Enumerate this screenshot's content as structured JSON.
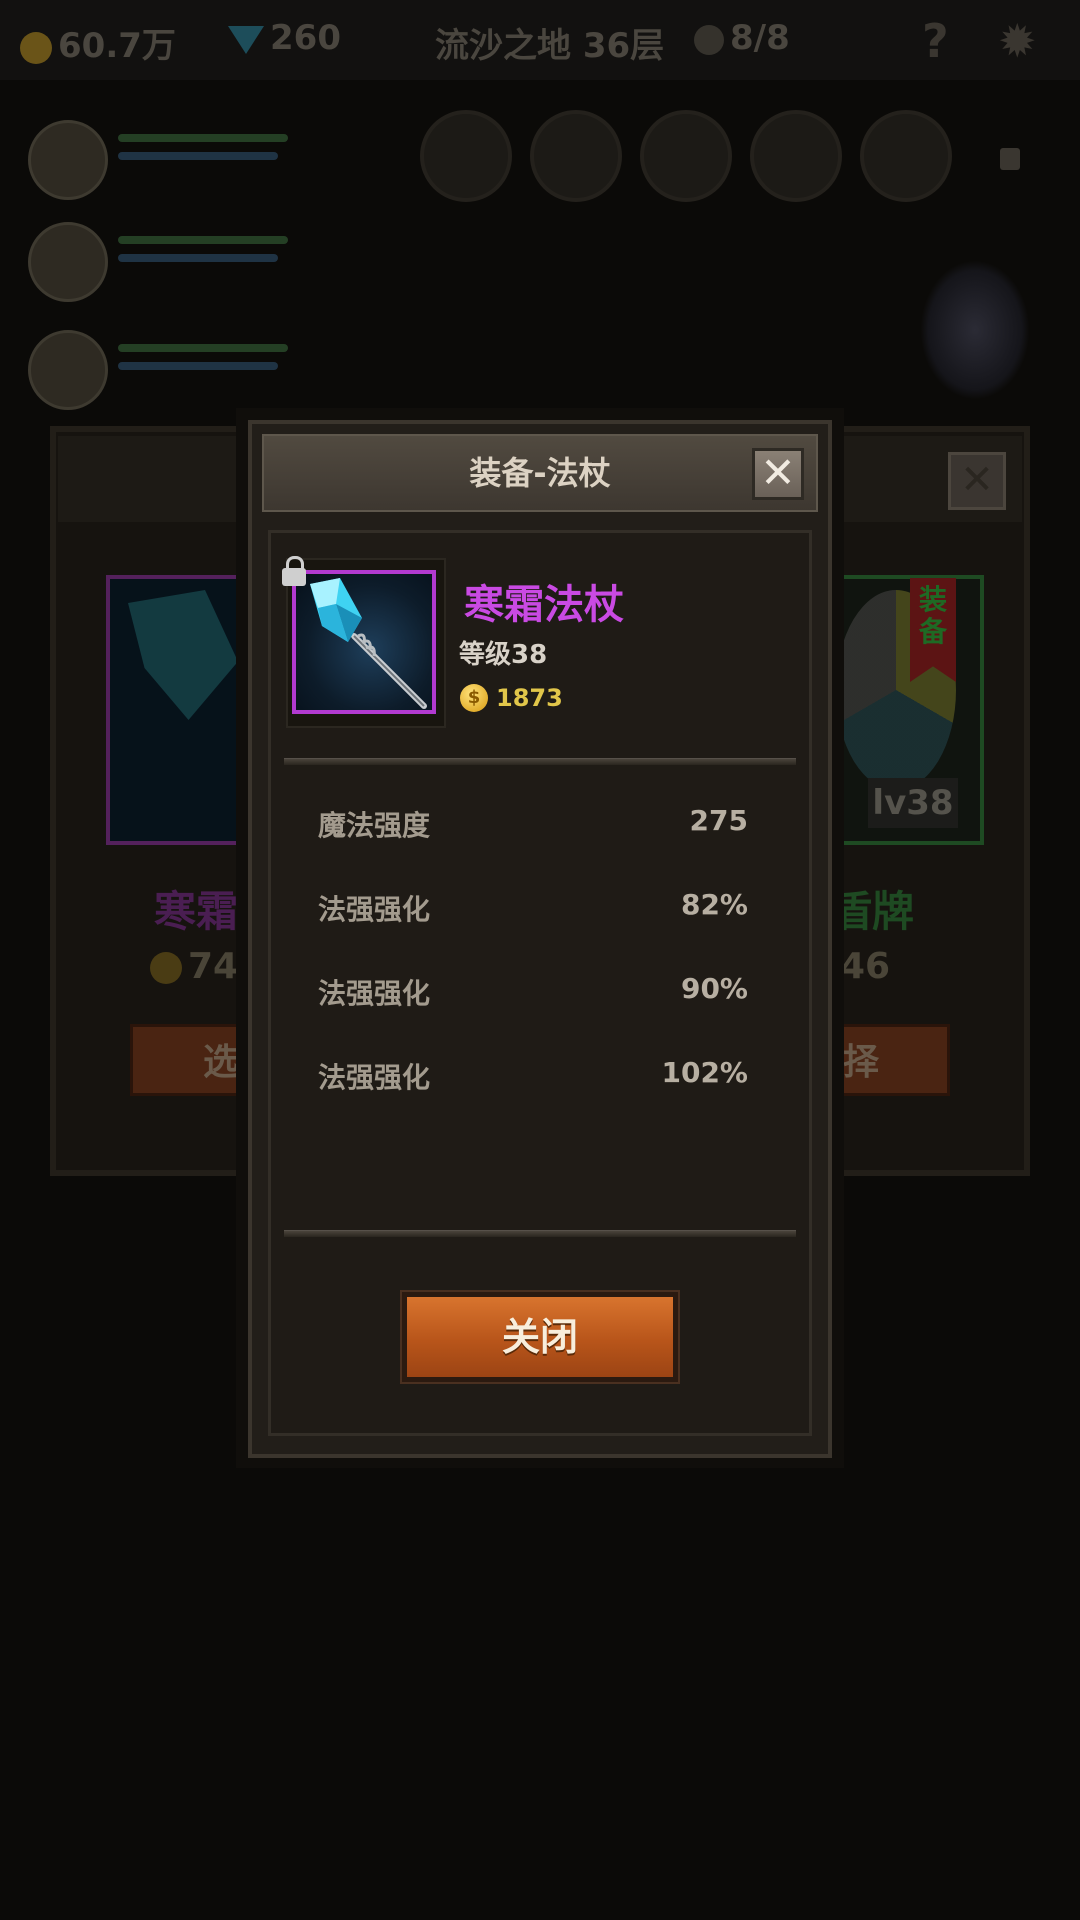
{
  "background": {
    "topbar": {
      "gold": "60.7万",
      "gems": "260",
      "location": "流沙之地 36层",
      "keys": "8/8",
      "help_icon": "question-icon",
      "settings_icon": "gear-icon"
    },
    "left_card": {
      "name_partial": "寒霜",
      "price_partial": "74",
      "button_partial": "选"
    },
    "right_card": {
      "badge": "装备",
      "level": "lv38",
      "name_partial": "盾牌",
      "price_partial": "46",
      "button_partial": "择"
    }
  },
  "modal": {
    "title": "装备-法杖",
    "close_icon": "close-icon",
    "item": {
      "name": "寒霜法杖",
      "level": "等级38",
      "price": "1873",
      "coin_symbol": "$",
      "rarity_color": "#c94ae3",
      "icon": "ice-staff-icon",
      "lock_icon": "lock-icon"
    },
    "stats": [
      {
        "label": "魔法强度",
        "value": "275"
      },
      {
        "label": "法强强化",
        "value": "82%"
      },
      {
        "label": "法强强化",
        "value": "90%"
      },
      {
        "label": "法强强化",
        "value": "102%"
      }
    ],
    "close_button": "关闭"
  }
}
